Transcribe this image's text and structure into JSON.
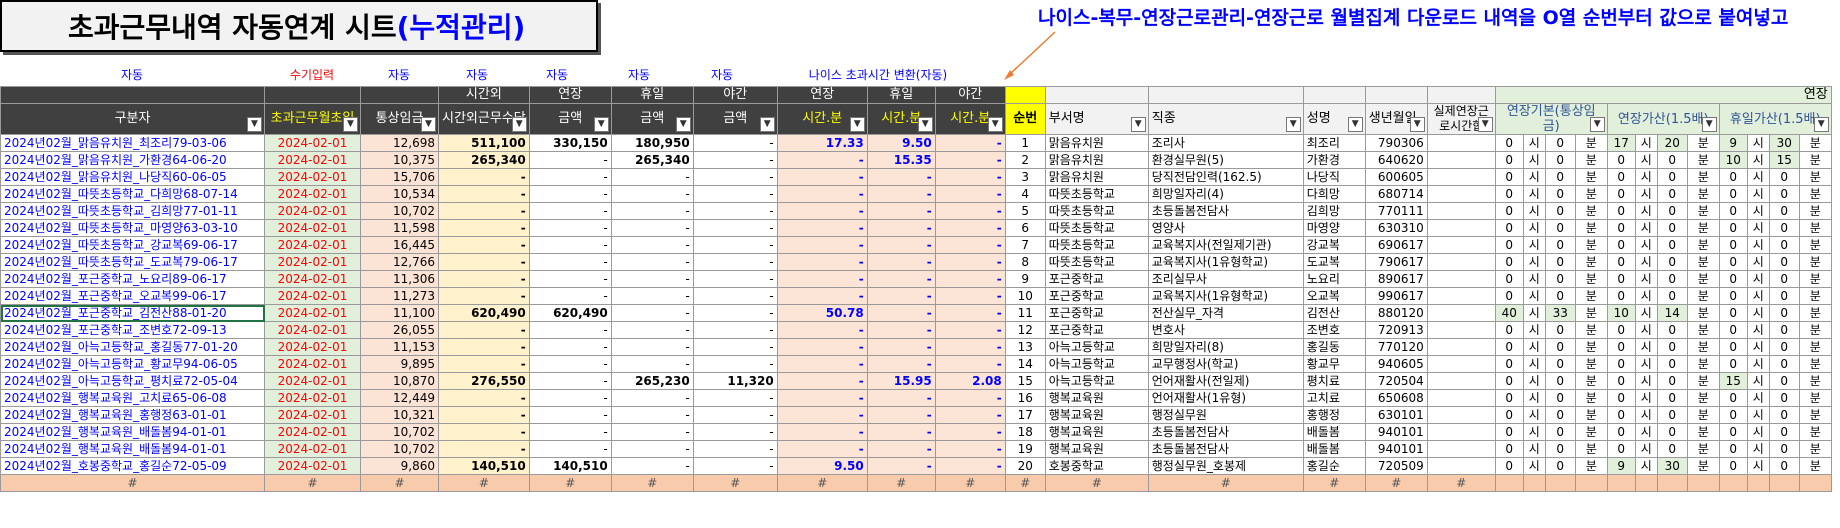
{
  "title": {
    "main": "초과근무내역 자동연계 시트",
    "sub": "(누적관리)"
  },
  "note": "나이스-복무-연장근로관리-연장근로 월별집계 다운로드 내역을 O열 순번부터 값으로 붙여넣고",
  "labels": {
    "auto": "자동",
    "manual": "수기입력",
    "neis": "나이스 초과시간 변환(자동)"
  },
  "headers": {
    "top_overtime": "시간외",
    "top_extension": "연장",
    "top_holiday": "휴일",
    "top_night": "야간",
    "top_ext2": "연장",
    "top_hol2": "휴일",
    "top_night2": "야간",
    "top_right": "연장",
    "divider": "구분자",
    "month": "초과근무월초일",
    "wage": "통상임금",
    "ot_pay": "시간외근무수당",
    "amount": "금액",
    "hm": "시간.분",
    "seq": "순번",
    "dept": "부서명",
    "job": "직종",
    "name": "성명",
    "birth": "생년월일",
    "actual": "실제연장근로시간합",
    "ext_base": "연장기본(통상임금)",
    "ext_add": "연장가산(1.5배)",
    "hol_add": "휴일가산(1.5배)",
    "si": "시",
    "bun": "분",
    "dash": "-",
    "foot_mark": "#"
  },
  "rows": [
    {
      "id": "2024년02월_맑음유치원_최조리79-03-06",
      "month": "2024-02-01",
      "wage": "12,698",
      "ot": "511,100",
      "ext": "330,150",
      "hol": "180,950",
      "night": "-",
      "ehm": "17.33",
      "hhm": "9.50",
      "nhm": "-",
      "seq": "1",
      "dept": "맑음유치원",
      "job": "조리사",
      "name": "최조리",
      "birth": "790306",
      "eb": [
        "0",
        "0"
      ],
      "ea": [
        "17",
        "20"
      ],
      "ha": [
        "9",
        "30"
      ]
    },
    {
      "id": "2024년02월_맑음유치원_가환경64-06-20",
      "month": "2024-02-01",
      "wage": "10,375",
      "ot": "265,340",
      "ext": "-",
      "hol": "265,340",
      "night": "-",
      "ehm": "-",
      "hhm": "15.35",
      "nhm": "-",
      "seq": "2",
      "dept": "맑음유치원",
      "job": "환경실무원(5)",
      "name": "가환경",
      "birth": "640620",
      "eb": [
        "0",
        "0"
      ],
      "ea": [
        "0",
        "0"
      ],
      "ha": [
        "10",
        "15"
      ]
    },
    {
      "id": "2024년02월_맑음유치원_나당직60-06-05",
      "month": "2024-02-01",
      "wage": "15,706",
      "ot": "-",
      "ext": "-",
      "hol": "-",
      "night": "-",
      "ehm": "-",
      "hhm": "-",
      "nhm": "-",
      "seq": "3",
      "dept": "맑음유치원",
      "job": "당직전담인력(162.5)",
      "name": "나당직",
      "birth": "600605",
      "eb": [
        "0",
        "0"
      ],
      "ea": [
        "0",
        "0"
      ],
      "ha": [
        "0",
        "0"
      ]
    },
    {
      "id": "2024년02월_따뜻초등학교_다희망68-07-14",
      "month": "2024-02-01",
      "wage": "10,534",
      "ot": "-",
      "ext": "-",
      "hol": "-",
      "night": "-",
      "ehm": "-",
      "hhm": "-",
      "nhm": "-",
      "seq": "4",
      "dept": "따뜻초등학교",
      "job": "희망일자리(4)",
      "name": "다희망",
      "birth": "680714",
      "eb": [
        "0",
        "0"
      ],
      "ea": [
        "0",
        "0"
      ],
      "ha": [
        "0",
        "0"
      ]
    },
    {
      "id": "2024년02월_따뜻초등학교_김희망77-01-11",
      "month": "2024-02-01",
      "wage": "10,702",
      "ot": "-",
      "ext": "-",
      "hol": "-",
      "night": "-",
      "ehm": "-",
      "hhm": "-",
      "nhm": "-",
      "seq": "5",
      "dept": "따뜻초등학교",
      "job": "초등돌봄전담사",
      "name": "김희망",
      "birth": "770111",
      "eb": [
        "0",
        "0"
      ],
      "ea": [
        "0",
        "0"
      ],
      "ha": [
        "0",
        "0"
      ]
    },
    {
      "id": "2024년02월_따뜻초등학교_마영양63-03-10",
      "month": "2024-02-01",
      "wage": "11,598",
      "ot": "-",
      "ext": "-",
      "hol": "-",
      "night": "-",
      "ehm": "-",
      "hhm": "-",
      "nhm": "-",
      "seq": "6",
      "dept": "따뜻초등학교",
      "job": "영양사",
      "name": "마영양",
      "birth": "630310",
      "eb": [
        "0",
        "0"
      ],
      "ea": [
        "0",
        "0"
      ],
      "ha": [
        "0",
        "0"
      ]
    },
    {
      "id": "2024년02월_따뜻초등학교_강교복69-06-17",
      "month": "2024-02-01",
      "wage": "16,445",
      "ot": "-",
      "ext": "-",
      "hol": "-",
      "night": "-",
      "ehm": "-",
      "hhm": "-",
      "nhm": "-",
      "seq": "7",
      "dept": "따뜻초등학교",
      "job": "교육복지사(전일제기관)",
      "name": "강교복",
      "birth": "690617",
      "eb": [
        "0",
        "0"
      ],
      "ea": [
        "0",
        "0"
      ],
      "ha": [
        "0",
        "0"
      ]
    },
    {
      "id": "2024년02월_따뜻초등학교_도교복79-06-17",
      "month": "2024-02-01",
      "wage": "12,766",
      "ot": "-",
      "ext": "-",
      "hol": "-",
      "night": "-",
      "ehm": "-",
      "hhm": "-",
      "nhm": "-",
      "seq": "8",
      "dept": "따뜻초등학교",
      "job": "교육복지사(1유형학교)",
      "name": "도교복",
      "birth": "790617",
      "eb": [
        "0",
        "0"
      ],
      "ea": [
        "0",
        "0"
      ],
      "ha": [
        "0",
        "0"
      ]
    },
    {
      "id": "2024년02월_포근중학교_노요리89-06-17",
      "month": "2024-02-01",
      "wage": "11,306",
      "ot": "-",
      "ext": "-",
      "hol": "-",
      "night": "-",
      "ehm": "-",
      "hhm": "-",
      "nhm": "-",
      "seq": "9",
      "dept": "포근중학교",
      "job": "조리실무사",
      "name": "노요리",
      "birth": "890617",
      "eb": [
        "0",
        "0"
      ],
      "ea": [
        "0",
        "0"
      ],
      "ha": [
        "0",
        "0"
      ]
    },
    {
      "id": "2024년02월_포근중학교_오교복99-06-17",
      "month": "2024-02-01",
      "wage": "11,273",
      "ot": "-",
      "ext": "-",
      "hol": "-",
      "night": "-",
      "ehm": "-",
      "hhm": "-",
      "nhm": "-",
      "seq": "10",
      "dept": "포근중학교",
      "job": "교육복지사(1유형학교)",
      "name": "오교복",
      "birth": "990617",
      "eb": [
        "0",
        "0"
      ],
      "ea": [
        "0",
        "0"
      ],
      "ha": [
        "0",
        "0"
      ]
    },
    {
      "id": "2024년02월_포근중학교_김전산88-01-20",
      "month": "2024-02-01",
      "wage": "11,100",
      "ot": "620,490",
      "ext": "620,490",
      "hol": "-",
      "night": "-",
      "ehm": "50.78",
      "hhm": "-",
      "nhm": "-",
      "seq": "11",
      "dept": "포근중학교",
      "job": "전산실무_자격",
      "name": "김전산",
      "birth": "880120",
      "eb": [
        "40",
        "33"
      ],
      "ea": [
        "10",
        "14"
      ],
      "ha": [
        "0",
        "0"
      ]
    },
    {
      "id": "2024년02월_포근중학교_조변호72-09-13",
      "month": "2024-02-01",
      "wage": "26,055",
      "ot": "-",
      "ext": "-",
      "hol": "-",
      "night": "-",
      "ehm": "-",
      "hhm": "-",
      "nhm": "-",
      "seq": "12",
      "dept": "포근중학교",
      "job": "변호사",
      "name": "조변호",
      "birth": "720913",
      "eb": [
        "0",
        "0"
      ],
      "ea": [
        "0",
        "0"
      ],
      "ha": [
        "0",
        "0"
      ]
    },
    {
      "id": "2024년02월_아늑고등학교_홍길동77-01-20",
      "month": "2024-02-01",
      "wage": "11,153",
      "ot": "-",
      "ext": "-",
      "hol": "-",
      "night": "-",
      "ehm": "-",
      "hhm": "-",
      "nhm": "-",
      "seq": "13",
      "dept": "아늑고등학교",
      "job": "희망일자리(8)",
      "name": "홍길동",
      "birth": "770120",
      "eb": [
        "0",
        "0"
      ],
      "ea": [
        "0",
        "0"
      ],
      "ha": [
        "0",
        "0"
      ]
    },
    {
      "id": "2024년02월_아늑고등학교_황교무94-06-05",
      "month": "2024-02-01",
      "wage": "9,895",
      "ot": "-",
      "ext": "-",
      "hol": "-",
      "night": "-",
      "ehm": "-",
      "hhm": "-",
      "nhm": "-",
      "seq": "14",
      "dept": "아늑고등학교",
      "job": "교무행정사(학교)",
      "name": "황교무",
      "birth": "940605",
      "eb": [
        "0",
        "0"
      ],
      "ea": [
        "0",
        "0"
      ],
      "ha": [
        "0",
        "0"
      ]
    },
    {
      "id": "2024년02월_아늑고등학교_평치료72-05-04",
      "month": "2024-02-01",
      "wage": "10,870",
      "ot": "276,550",
      "ext": "-",
      "hol": "265,230",
      "night": "11,320",
      "ehm": "-",
      "hhm": "15.95",
      "nhm": "2.08",
      "seq": "15",
      "dept": "아늑고등학교",
      "job": "언어재활사(전일제)",
      "name": "평치료",
      "birth": "720504",
      "eb": [
        "0",
        "0"
      ],
      "ea": [
        "0",
        "0"
      ],
      "ha": [
        "15",
        "0"
      ]
    },
    {
      "id": "2024년02월_행복교육원_고치료65-06-08",
      "month": "2024-02-01",
      "wage": "12,449",
      "ot": "-",
      "ext": "-",
      "hol": "-",
      "night": "-",
      "ehm": "-",
      "hhm": "-",
      "nhm": "-",
      "seq": "16",
      "dept": "행복교육원",
      "job": "언어재활사(1유형)",
      "name": "고치료",
      "birth": "650608",
      "eb": [
        "0",
        "0"
      ],
      "ea": [
        "0",
        "0"
      ],
      "ha": [
        "0",
        "0"
      ]
    },
    {
      "id": "2024년02월_행복교육원_홍행정63-01-01",
      "month": "2024-02-01",
      "wage": "10,321",
      "ot": "-",
      "ext": "-",
      "hol": "-",
      "night": "-",
      "ehm": "-",
      "hhm": "-",
      "nhm": "-",
      "seq": "17",
      "dept": "행복교육원",
      "job": "행정실무원",
      "name": "홍행정",
      "birth": "630101",
      "eb": [
        "0",
        "0"
      ],
      "ea": [
        "0",
        "0"
      ],
      "ha": [
        "0",
        "0"
      ]
    },
    {
      "id": "2024년02월_행복교육원_배돌봄94-01-01",
      "month": "2024-02-01",
      "wage": "10,702",
      "ot": "-",
      "ext": "-",
      "hol": "-",
      "night": "-",
      "ehm": "-",
      "hhm": "-",
      "nhm": "-",
      "seq": "18",
      "dept": "행복교육원",
      "job": "초등돌봄전담사",
      "name": "배돌봄",
      "birth": "940101",
      "eb": [
        "0",
        "0"
      ],
      "ea": [
        "0",
        "0"
      ],
      "ha": [
        "0",
        "0"
      ]
    },
    {
      "id": "2024년02월_행복교육원_배돌봄94-01-01",
      "month": "2024-02-01",
      "wage": "10,702",
      "ot": "-",
      "ext": "-",
      "hol": "-",
      "night": "-",
      "ehm": "-",
      "hhm": "-",
      "nhm": "-",
      "seq": "19",
      "dept": "행복교육원",
      "job": "초등돌봄전담사",
      "name": "배돌봄",
      "birth": "940101",
      "eb": [
        "0",
        "0"
      ],
      "ea": [
        "0",
        "0"
      ],
      "ha": [
        "0",
        "0"
      ]
    },
    {
      "id": "2024년02월_호봉중학교_홍길순72-05-09",
      "month": "2024-02-01",
      "wage": "9,860",
      "ot": "140,510",
      "ext": "140,510",
      "hol": "-",
      "night": "-",
      "ehm": "9.50",
      "hhm": "-",
      "nhm": "-",
      "seq": "20",
      "dept": "호봉중학교",
      "job": "행정실무원_호봉제",
      "name": "홍길순",
      "birth": "720509",
      "eb": [
        "0",
        "0"
      ],
      "ea": [
        "9",
        "30"
      ],
      "ha": [
        "0",
        "0"
      ]
    }
  ]
}
